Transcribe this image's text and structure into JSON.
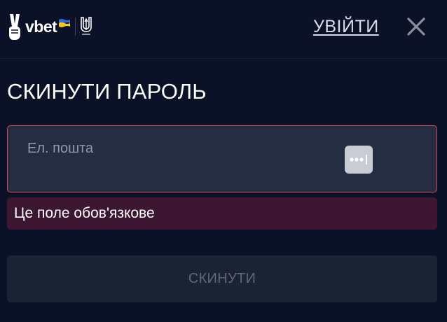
{
  "header": {
    "logo": {
      "brand_text": "vbet",
      "flag_colors": {
        "top": "#2a6bd6",
        "bottom": "#f5c518"
      }
    },
    "login_link": "УВІЙТИ",
    "close_icon": "close-icon"
  },
  "form": {
    "title": "СКИНУТИ ПАРОЛЬ",
    "email": {
      "label": "Ел. пошта",
      "value": "",
      "password_manager_icon": "password-dots-icon"
    },
    "error_message": "Це поле обов'язкове",
    "submit_label": "СКИНУТИ",
    "submit_disabled": true
  },
  "colors": {
    "background": "#0b1127",
    "field_background": "#252d43",
    "field_border_error": "#e0415c",
    "error_background": "#3d1731",
    "button_disabled_background": "#1a2234",
    "button_disabled_text": "#5f6678"
  }
}
